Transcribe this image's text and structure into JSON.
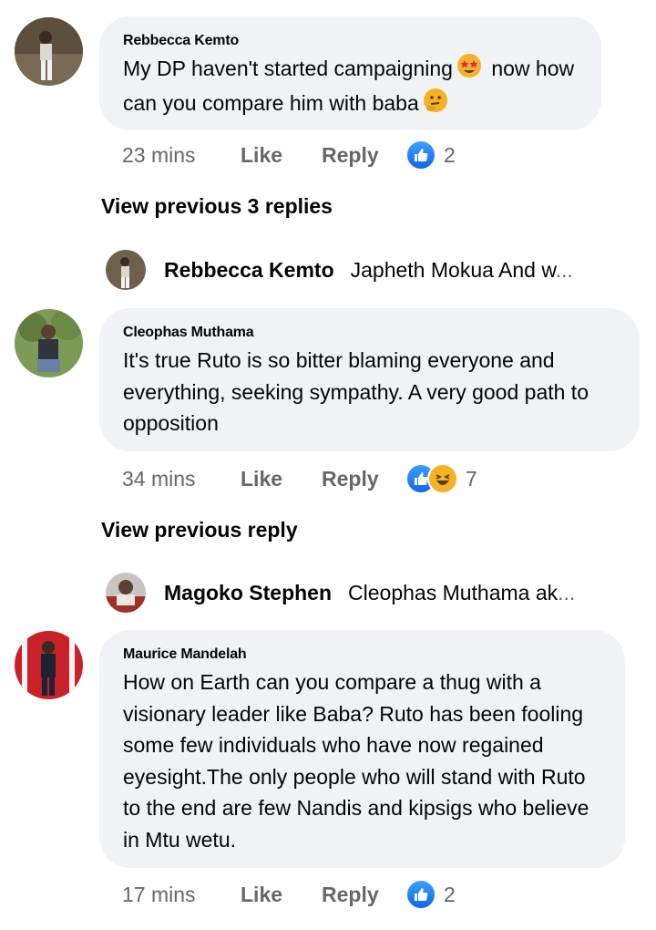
{
  "comments": [
    {
      "author": "Rebbecca Kemto",
      "text_before_emoji": "My DP haven't started campaigning",
      "emoji1": "star-struck-emoji",
      "text_after_emoji": "now how can you compare him with baba",
      "emoji2": "thinking-emoji",
      "time": "23 mins",
      "like_label": "Like",
      "reply_label": "Reply",
      "reaction_count": "2",
      "reactions": [
        "like"
      ]
    },
    {
      "author": "Cleophas Muthama",
      "text": "It's true Ruto is so bitter blaming everyone and everything, seeking sympathy. A very good path to opposition",
      "time": "34 mins",
      "like_label": "Like",
      "reply_label": "Reply",
      "reaction_count": "7",
      "reactions": [
        "like",
        "haha"
      ]
    },
    {
      "author": "Maurice Mandelah",
      "text": "How on Earth can you compare a thug with a visionary leader like Baba? Ruto  has been fooling some few individuals who have now regained eyesight.The only people who will stand with Ruto to the end are few Nandis and kipsigs who believe in Mtu wetu.",
      "time": "17 mins",
      "like_label": "Like",
      "reply_label": "Reply",
      "reaction_count": "2",
      "reactions": [
        "like"
      ]
    }
  ],
  "view_previous": [
    "View previous 3 replies",
    "View previous reply"
  ],
  "reply_previews": [
    {
      "author": "Rebbecca Kemto",
      "text": "Japheth Mokua  And w",
      "ellipsis": "..."
    },
    {
      "author": "Magoko Stephen",
      "text": "Cleophas Muthama  ak",
      "ellipsis": "..."
    }
  ],
  "colors": {
    "bubble": "#f0f2f5",
    "meta": "#65676b",
    "like_blue": "#1877f2"
  }
}
